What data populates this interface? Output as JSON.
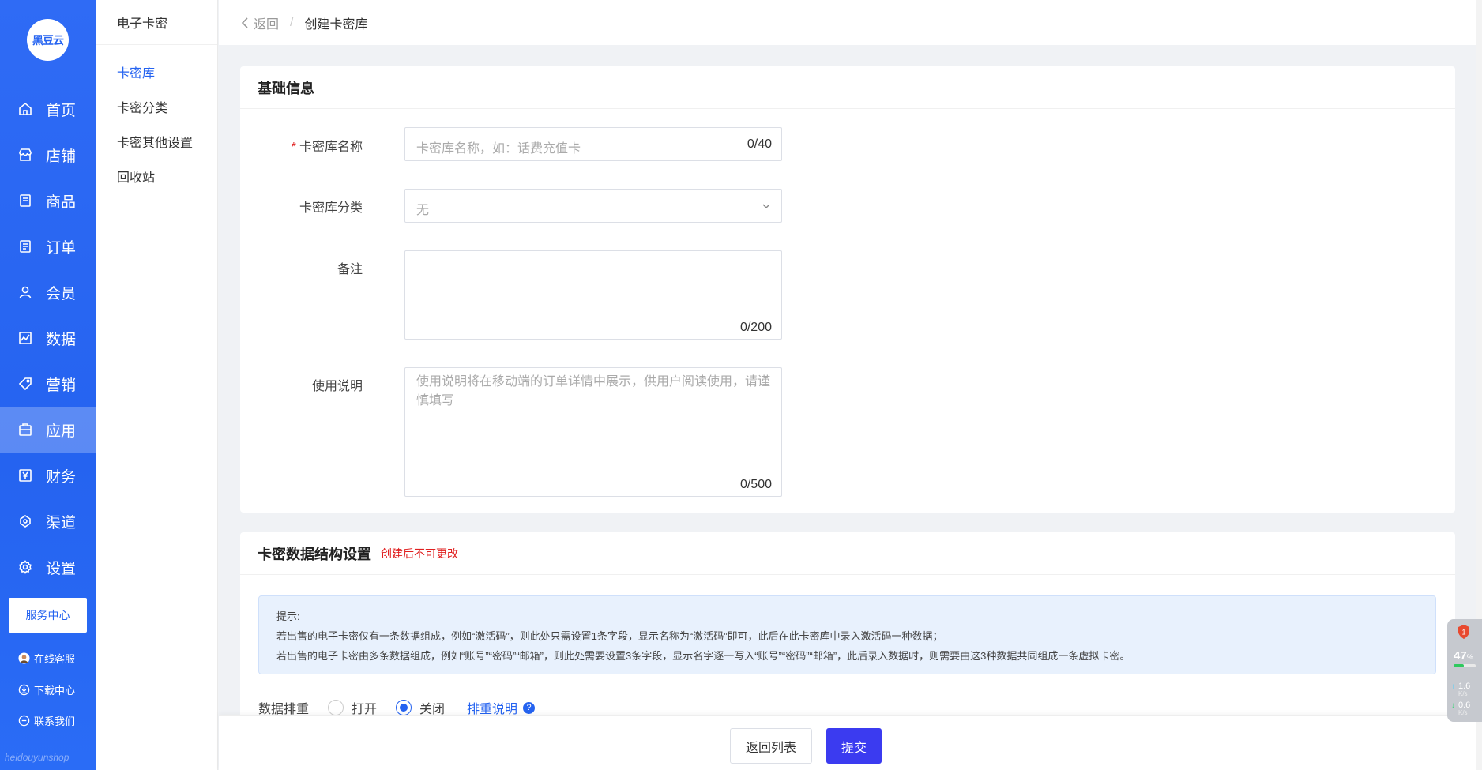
{
  "sidebar": {
    "logo_text": "黑豆云",
    "items": [
      {
        "label": "首页",
        "icon": "home-icon"
      },
      {
        "label": "店铺",
        "icon": "store-icon"
      },
      {
        "label": "商品",
        "icon": "product-icon"
      },
      {
        "label": "订单",
        "icon": "order-icon"
      },
      {
        "label": "会员",
        "icon": "user-icon"
      },
      {
        "label": "数据",
        "icon": "chart-icon"
      },
      {
        "label": "营销",
        "icon": "tag-icon"
      },
      {
        "label": "应用",
        "icon": "app-icon",
        "active": true
      },
      {
        "label": "财务",
        "icon": "finance-icon"
      },
      {
        "label": "渠道",
        "icon": "channel-icon"
      },
      {
        "label": "设置",
        "icon": "gear-icon"
      }
    ],
    "service_center": "服务中心",
    "online_service": "在线客服",
    "download_center": "下载中心",
    "contact_us": "联系我们",
    "watermark": "heidouyunshop"
  },
  "subnav": {
    "title": "电子卡密",
    "items": [
      "卡密库",
      "卡密分类",
      "卡密其他设置",
      "回收站"
    ],
    "active_index": 0
  },
  "header": {
    "back": "返回",
    "separator": "/",
    "current": "创建卡密库"
  },
  "basic": {
    "title": "基础信息",
    "name_label": "卡密库名称",
    "name_placeholder": "卡密库名称，如：话费充值卡",
    "name_count": "0/40",
    "category_label": "卡密库分类",
    "category_value": "无",
    "remark_label": "备注",
    "remark_count": "0/200",
    "usage_label": "使用说明",
    "usage_placeholder": "使用说明将在移动端的订单详情中展示，供用户阅读使用，请谨慎填写",
    "usage_count": "0/500"
  },
  "structure": {
    "title": "卡密数据结构设置",
    "warning": "创建后不可更改",
    "tip_title": "提示:",
    "tip_line1": "若出售的电子卡密仅有一条数据组成，例如“激活码”，则此处只需设置1条字段，显示名称为“激活码”即可，此后在此卡密库中录入激活码一种数据；",
    "tip_line2": "若出售的电子卡密由多条数据组成，例如“账号”“密码”“邮箱”，则此处需要设置3条字段，显示名字逐一写入“账号”“密码”“邮箱”，此后录入数据时，则需要由这3种数据共同组成一条虚拟卡密。",
    "dedupe_label": "数据排重",
    "open": "打开",
    "close": "关闭",
    "selected": "close",
    "dedupe_help": "排重说明"
  },
  "footer": {
    "back_list": "返回列表",
    "submit": "提交"
  },
  "widget": {
    "percent": "47",
    "percent_unit": "%",
    "up_speed": "1.6",
    "down_speed": "0.6",
    "unit": "K/s",
    "fill_fraction": 0.46
  },
  "colors": {
    "primary": "#2563f0",
    "submit": "#3b3bf0",
    "warning": "#e02020",
    "tip_bg": "#e8f1fd"
  }
}
